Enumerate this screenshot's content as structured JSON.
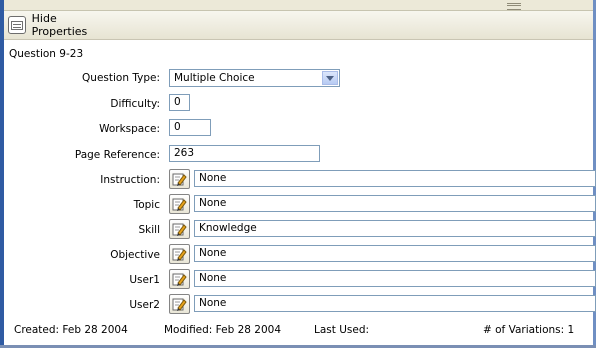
{
  "toolbar": {
    "hide_properties_label": "Hide Properties"
  },
  "question": {
    "title": "Question  9-23"
  },
  "fields": {
    "question_type": {
      "label": "Question Type:",
      "value": "Multiple Choice"
    },
    "difficulty": {
      "label": "Difficulty:",
      "value": "0"
    },
    "workspace": {
      "label": "Workspace:",
      "value": "0"
    },
    "page_reference": {
      "label": "Page Reference:",
      "value": "263"
    },
    "instruction": {
      "label": "Instruction:",
      "value": "None"
    },
    "topic": {
      "label": "Topic",
      "value": "None"
    },
    "skill": {
      "label": "Skill",
      "value": "Knowledge"
    },
    "objective": {
      "label": "Objective",
      "value": "None"
    },
    "user1": {
      "label": "User1",
      "value": "None"
    },
    "user2": {
      "label": "User2",
      "value": "None"
    }
  },
  "footer": {
    "created": "Created:  Feb 28 2004",
    "modified": "Modified:  Feb 28 2004",
    "last_used": "Last Used:",
    "variations": "# of Variations: 1"
  },
  "icons": {
    "hide_properties": "properties-icon",
    "edit": "edit-pencil-icon",
    "dropdown": "chevron-down-icon"
  }
}
